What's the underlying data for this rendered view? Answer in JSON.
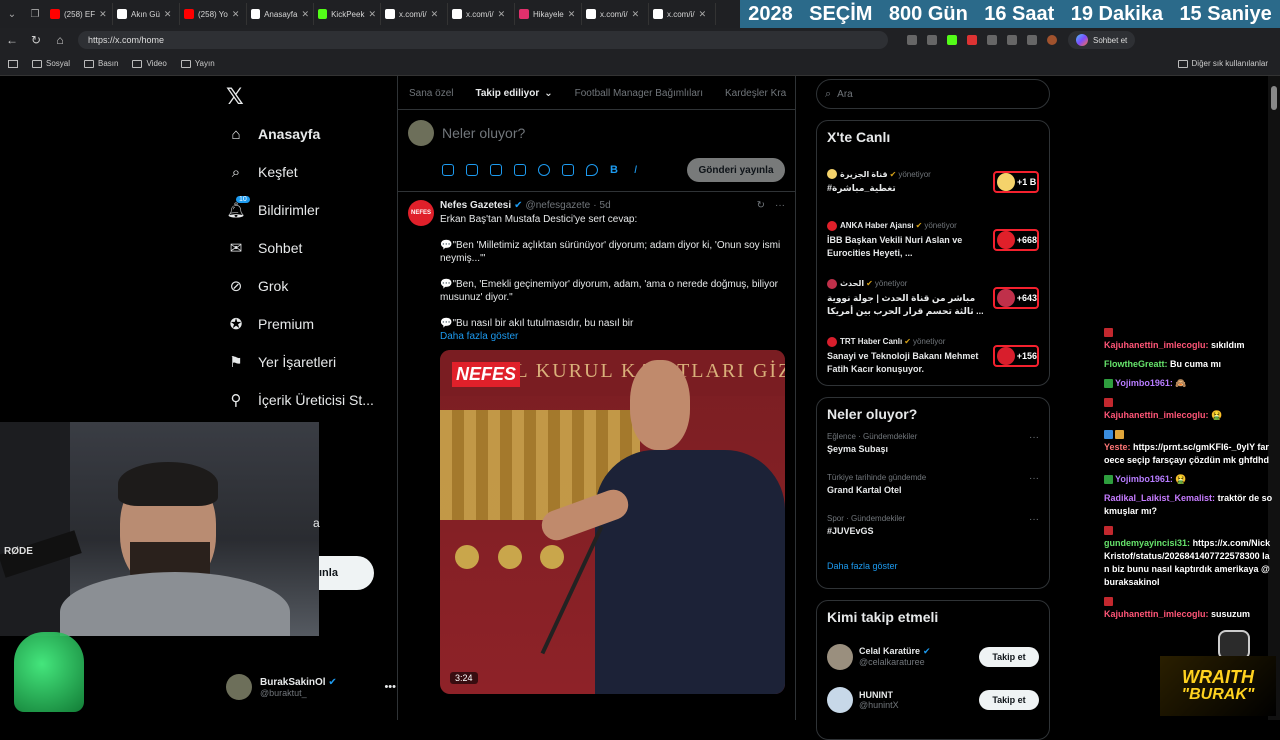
{
  "browser": {
    "tabs": [
      {
        "label": "(258) EF",
        "color": "#ff0000"
      },
      {
        "label": "Akın Gü",
        "color": "#ffffff"
      },
      {
        "label": "(258) Yo",
        "color": "#ff0000"
      },
      {
        "label": "Anasayfa",
        "color": "#ffffff"
      },
      {
        "label": "KickPeek",
        "color": "#53fc18"
      },
      {
        "label": "x.com/i/",
        "color": "#ffffff"
      },
      {
        "label": "x.com/i/",
        "color": "#ffffff"
      },
      {
        "label": "Hikayele",
        "color": "#e1306c"
      },
      {
        "label": "x.com/i/",
        "color": "#ffffff"
      },
      {
        "label": "x.com/i/",
        "color": "#ffffff"
      }
    ],
    "url": "https://x.com/home",
    "sohbet_label": "Sohbet et",
    "bookmarks": [
      "Sosyal",
      "Basın",
      "Video",
      "Yayın"
    ],
    "bookmarks_other": "Diğer sık kullanılanlar"
  },
  "countdown": {
    "year": "2028",
    "label": "SEÇİM",
    "days": "800 Gün",
    "hours": "16 Saat",
    "minutes": "19 Dakika",
    "seconds": "15 Saniye"
  },
  "nav": {
    "items": [
      {
        "label": "Anasayfa",
        "icon": "home-icon",
        "bold": true
      },
      {
        "label": "Keşfet",
        "icon": "search-icon"
      },
      {
        "label": "Bildirimler",
        "icon": "bell-icon",
        "badge": "10"
      },
      {
        "label": "Sohbet",
        "icon": "mail-icon"
      },
      {
        "label": "Grok",
        "icon": "grok-icon"
      },
      {
        "label": "Premium",
        "icon": "verified-icon"
      },
      {
        "label": "Yer İşaretleri",
        "icon": "bookmark-icon"
      },
      {
        "label": "İçerik Üreticisi St...",
        "icon": "creator-icon"
      }
    ],
    "post_button_partial": "ınla",
    "partial_item": "a",
    "profile": {
      "name": "BurakSakinOl",
      "handle": "@buraktut_"
    }
  },
  "feed": {
    "tabs": [
      "Sana özel",
      "Takip ediliyor",
      "Football Manager Bağımlıları",
      "Kardeşler Kra"
    ],
    "active_tab": "Takip ediliyor",
    "compose_placeholder": "Neler oluyor?",
    "post_button": "Gönderi yayınla",
    "tweet": {
      "author": "Nefes Gazetesi",
      "handle": "@nefesgazete",
      "time": "5d",
      "avatar_text": "NEFES",
      "lines": [
        "Erkan Baş'tan Mustafa Destici'ye sert cevap:",
        "💬\"Ben 'Milletimiz açlıktan sürünüyor' diyorum; adam diyor ki, 'Onun soy ismi neymiş...'\"",
        "💬\"Ben, 'Emekli geçinemiyor' diyorum, adam, 'ama o nerede doğmuş, biliyor musunuz' diyor.\"",
        "💬\"Bu nasıl bir akıl tutulmasıdır, bu nasıl bir"
      ],
      "show_more": "Daha fazla göster",
      "video_duration": "3:24",
      "video_overlay": "NEFES",
      "backdrop_text": "GENEL KURUL KAYITLARI GİZLİDİR"
    }
  },
  "right": {
    "search_placeholder": "Ara",
    "live": {
      "title": "X'te Canlı",
      "items": [
        {
          "host": "قناة الجزيرة",
          "role": "yönetiyor",
          "title": "#تغطية_مباشرة",
          "count": "+1 B",
          "color": "#f5d36b"
        },
        {
          "host": "ANKA Haber Ajansı",
          "role": "yönetiyor",
          "title": "İBB Başkan Vekili Nuri Aslan ve Eurocities Heyeti, ...",
          "count": "+668",
          "color": "#e0202a"
        },
        {
          "host": "الحدث",
          "role": "yönetiyor",
          "title": "مباشر من قناة الحدث | جولة نووية ثالثة تحسم قرار الحرب بين أمريكا ...",
          "count": "+643",
          "color": "#c0304a"
        },
        {
          "host": "TRT Haber Canlı",
          "role": "yönetiyor",
          "title": "Sanayi ve Teknoloji Bakanı Mehmet Fatih Kacır konuşuyor.",
          "count": "+156",
          "color": "#d81e2c"
        }
      ]
    },
    "trends": {
      "title": "Neler oluyor?",
      "items": [
        {
          "meta": "Eğlence · Gündemdekiler",
          "name": "Şeyma Subaşı"
        },
        {
          "meta": "Türkiye tarihinde gündemde",
          "name": "Grand Kartal Otel"
        },
        {
          "meta": "Spor · Gündemdekiler",
          "name": "#JUVEvGS"
        }
      ],
      "show_more": "Daha fazla göster"
    },
    "who_to_follow": {
      "title": "Kimi takip etmeli",
      "items": [
        {
          "name": "Celal Karatüre",
          "handle": "@celalkaraturee",
          "button": "Takip et"
        },
        {
          "name": "HUNINT",
          "handle": "@hunintX",
          "button": "Takip et"
        }
      ]
    }
  },
  "chat": {
    "messages": [
      {
        "user": "Kajuhanettin_imlecoglu:",
        "text": "sıkıldım",
        "color": "#ff5577",
        "badge": "red"
      },
      {
        "user": "FlowtheGreatt:",
        "text": "Bu cuma mı",
        "color": "#66e36b",
        "badge": ""
      },
      {
        "user": "Yojimbo1961:",
        "text": "🙈",
        "color": "#b77cff",
        "badge": "green"
      },
      {
        "user": "Kajuhanettin_imlecoglu:",
        "text": "🤮",
        "color": "#ff5577",
        "badge": "red"
      },
      {
        "user": "Yeste:",
        "text": "https://prnt.sc/gmKFI6-_0yIY faroece seçip farsçayı çözdün mk ghfdhd",
        "color": "#ff7777",
        "badge": "icons"
      },
      {
        "user": "Yojimbo1961:",
        "text": "🤮",
        "color": "#b77cff",
        "badge": "green"
      },
      {
        "user": "Radikal_Laikist_Kemalist:",
        "text": "traktör de sokmuşlar mı?",
        "color": "#c67cff",
        "badge": ""
      },
      {
        "user": "gundemyayincisi31:",
        "text": "https://x.com/NickKristof/status/2026841407722578300 lan biz bunu nasıl kaptırdık amerikaya @buraksakinol",
        "color": "#66e36b",
        "badge": "red"
      },
      {
        "user": "Kajuhanettin_imlecoglu:",
        "text": "susuzum",
        "color": "#ff5577",
        "badge": "red"
      }
    ]
  },
  "webcam": {
    "mic_label": "RØDE"
  },
  "overlay_logo": {
    "line1": "WRAITH",
    "line2": "\"BURAK\""
  }
}
